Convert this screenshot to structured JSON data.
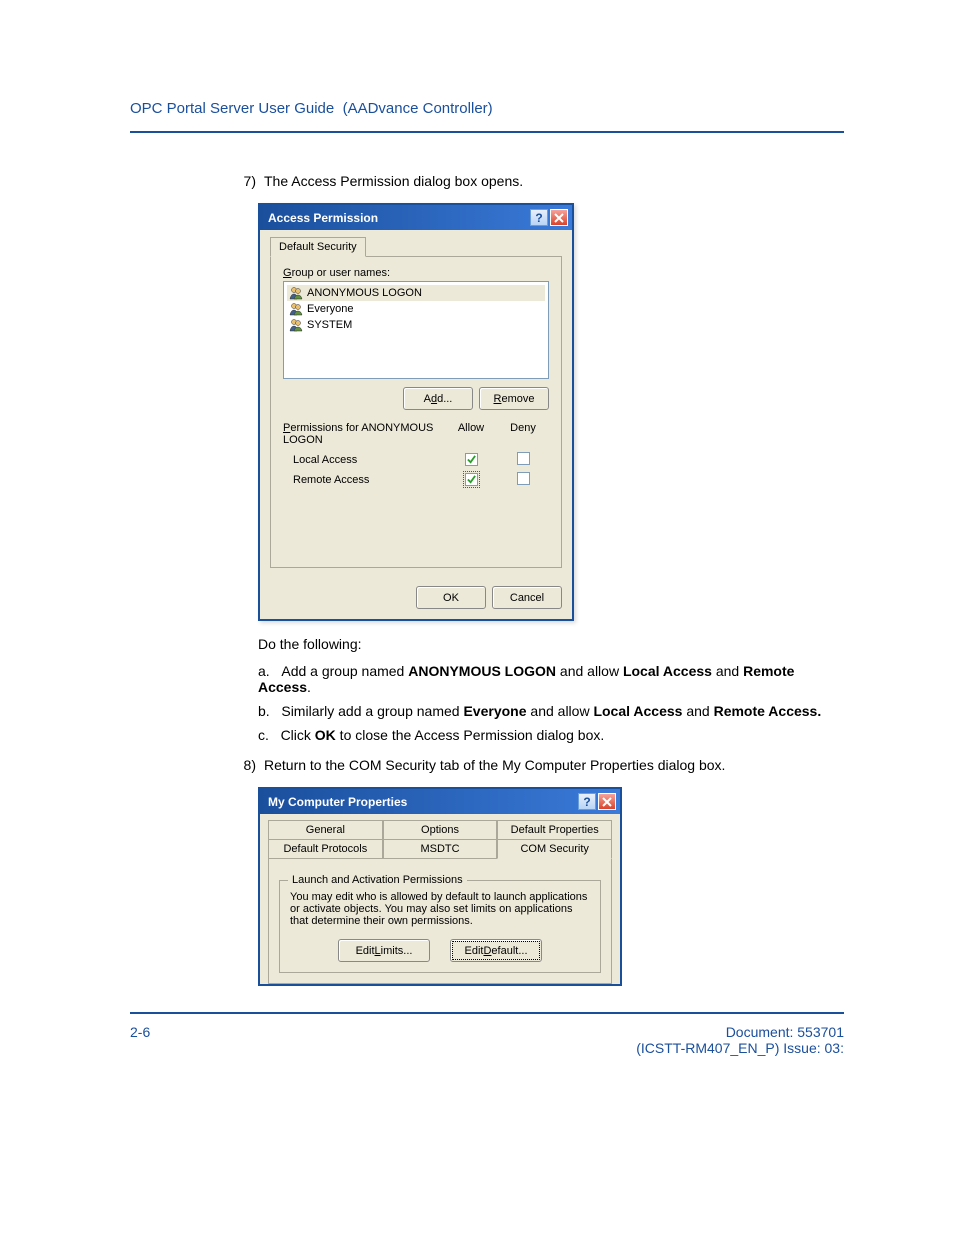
{
  "header": {
    "doc_title": "OPC Portal Server User Guide",
    "doc_subtitle": "(AADvance Controller)"
  },
  "steps": {
    "s7_num": "7)",
    "s7_text": "The Access Permission dialog box opens.",
    "intro": "Do the following:",
    "sa_prefix": "a.",
    "sa_1": "Add a group named ",
    "sa_b1": "ANONYMOUS LOGON",
    "sa_2": " and allow ",
    "sa_b2": "Local Access",
    "sa_3": " and ",
    "sa_b3": "Remote Access",
    "sa_4": ".",
    "sb_prefix": "b.",
    "sb_1": "Similarly add a group named ",
    "sb_b1": "Everyone",
    "sb_2": " and allow ",
    "sb_b2": "Local Access",
    "sb_3": " and ",
    "sb_b3": "Remote Access.",
    "sc_prefix": "c.",
    "sc_1": "Click ",
    "sc_b1": "OK",
    "sc_2": " to close the Access Permission dialog box.",
    "s8_num": "8)",
    "s8_text": "Return to the COM Security tab of the My Computer Properties dialog box."
  },
  "dlg1": {
    "title": "Access Permission",
    "tab": "Default Security",
    "group_label_pre": "G",
    "group_label_post": "roup or user names:",
    "users": {
      "u0": "ANONYMOUS LOGON",
      "u1": "Everyone",
      "u2": "SYSTEM"
    },
    "add_pre": "A",
    "add_u": "d",
    "add_post": "d...",
    "remove_u": "R",
    "remove_post": "emove",
    "perm_for_u": "P",
    "perm_for_post": "ermissions for ANONYMOUS LOGON",
    "allow": "Allow",
    "deny": "Deny",
    "local": "Local Access",
    "remote": "Remote Access",
    "ok": "OK",
    "cancel": "Cancel"
  },
  "dlg2": {
    "title": "My Computer Properties",
    "tabs_top": {
      "t0": "General",
      "t1": "Options",
      "t2": "Default Properties"
    },
    "tabs_bot": {
      "t0": "Default Protocols",
      "t1": "MSDTC",
      "t2": "COM Security"
    },
    "group_legend": "Launch and Activation Permissions",
    "group_text": "You may edit who is allowed by default to launch applications or activate objects. You may also set limits on applications that determine their own permissions.",
    "edit_limits_pre": "Edit ",
    "edit_limits_u": "L",
    "edit_limits_post": "imits...",
    "edit_default_pre": "Edit ",
    "edit_default_u": "D",
    "edit_default_post": "efault..."
  },
  "footer": {
    "page": "2-6",
    "doc_num": "Document: 553701",
    "issue": "(ICSTT-RM407_EN_P) Issue: 03:"
  }
}
